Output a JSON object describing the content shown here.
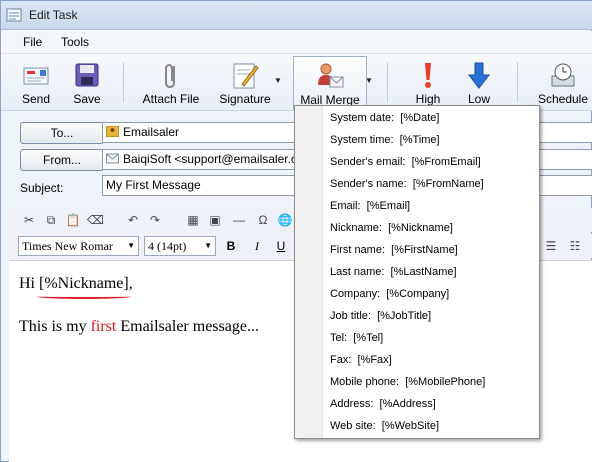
{
  "window": {
    "title": "Edit Task"
  },
  "menu": [
    "File",
    "Tools"
  ],
  "toolbar": {
    "send": "Send",
    "save": "Save",
    "attach_file": "Attach File",
    "signature": "Signature",
    "mail_merge": "Mail Merge",
    "high": "High",
    "low": "Low",
    "schedule": "Schedule"
  },
  "header": {
    "to_button": "To...",
    "to_value": "Emailsaler",
    "from_button": "From...",
    "from_value": "BaiqiSoft <support@emailsaler.com",
    "subject_label": "Subject:",
    "subject_value": "My First Message"
  },
  "format": {
    "font": "Times New Romar",
    "size": "4 (14pt)",
    "bold": "B",
    "italic": "I",
    "underline": "U"
  },
  "body": {
    "greeting_start": "Hi ",
    "nickname_tag": "[%Nickname]",
    "greeting_end": ",",
    "line2_start": "This is my ",
    "line2_highlight": "first",
    "line2_end": " Emailsaler message..."
  },
  "mail_merge_menu": [
    "System date:  [%Date]",
    "System time:  [%Time]",
    "Sender's email:  [%FromEmail]",
    "Sender's name:  [%FromName]",
    "Email:  [%Email]",
    "Nickname:  [%Nickname]",
    "First name:  [%FirstName]",
    "Last name:  [%LastName]",
    "Company:  [%Company]",
    "Job title:  [%JobTitle]",
    "Tel:  [%Tel]",
    "Fax:  [%Fax]",
    "Mobile phone:  [%MobilePhone]",
    "Address:  [%Address]",
    "Web site:  [%WebSite]"
  ],
  "colors": {
    "accent_red": "#d4141c",
    "arrow_blue": "#2a6fd6"
  }
}
